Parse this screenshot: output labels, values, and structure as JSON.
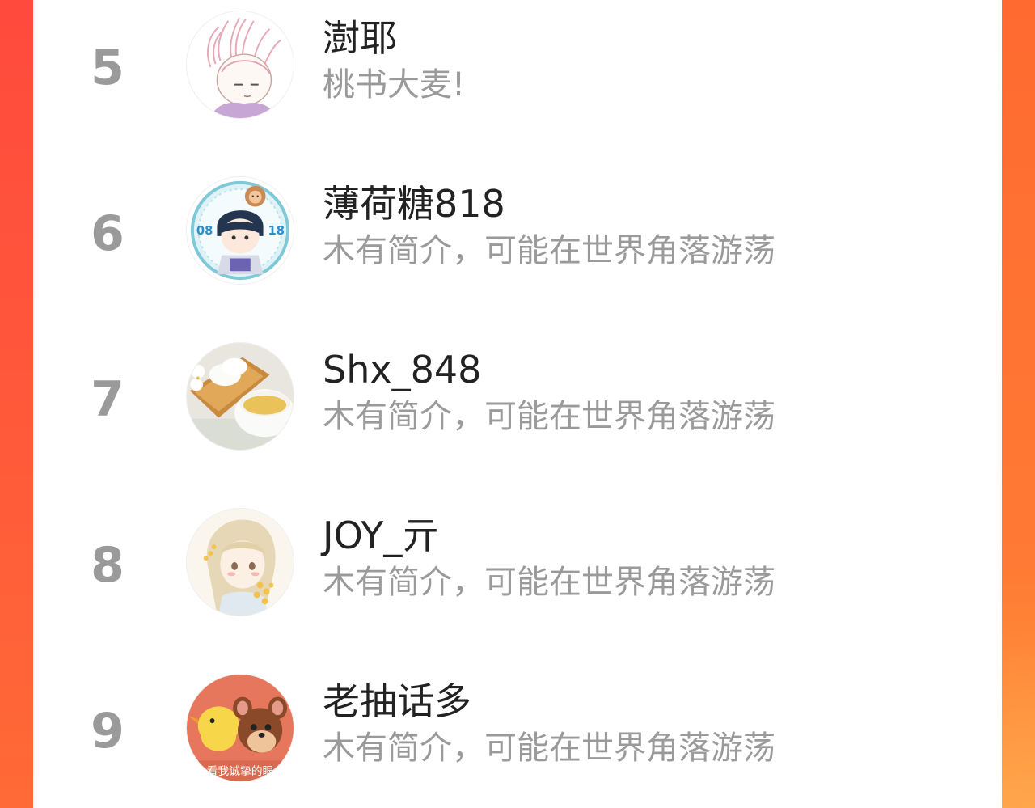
{
  "ranking": {
    "items": [
      {
        "rank": "5",
        "name": "澍耶",
        "bio": "桃书大麦!",
        "avatar_icon": "avatar-sketch-girl-icon"
      },
      {
        "rank": "6",
        "name": "薄荷糖818",
        "bio": "木有简介，可能在世界角落游荡",
        "avatar_icon": "avatar-birthday-boy-icon",
        "avatar_text": [
          "08",
          "18"
        ]
      },
      {
        "rank": "7",
        "name": "Shx_848",
        "bio": "木有简介，可能在世界角落游荡",
        "avatar_icon": "avatar-tea-cup-icon"
      },
      {
        "rank": "8",
        "name": "JOY_亓",
        "bio": "木有简介，可能在世界角落游荡",
        "avatar_icon": "avatar-anime-girl-icon"
      },
      {
        "rank": "9",
        "name": "老抽话多",
        "bio": "木有简介，可能在世界角落游荡",
        "avatar_icon": "avatar-cartoon-mouse-icon",
        "avatar_text": "看我诚挚的眼"
      }
    ]
  },
  "colors": {
    "background_left": "#ff4a3d",
    "background_right": "#ff7a34",
    "card": "#ffffff",
    "rank_text": "#9a9a9a",
    "name_text": "#222222",
    "bio_text": "#9a9a9a"
  }
}
